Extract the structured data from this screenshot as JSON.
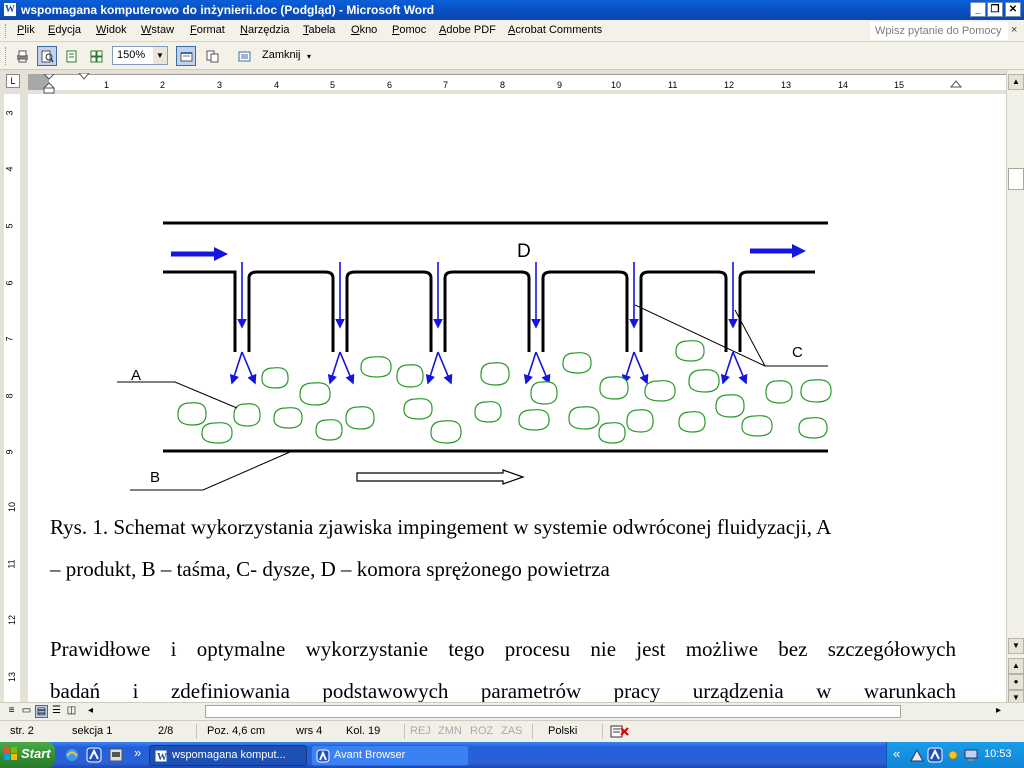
{
  "window": {
    "title": "wspomagana komputerowo do inżynierii.doc (Podgląd) - Microsoft Word",
    "controls": {
      "minimize": "_",
      "restore": "❐",
      "close": "✕"
    }
  },
  "menu": {
    "items": [
      "Plik",
      "Edycja",
      "Widok",
      "Wstaw",
      "Format",
      "Narzędzia",
      "Tabela",
      "Okno",
      "Pomoc",
      "Adobe PDF",
      "Acrobat Comments"
    ],
    "help_placeholder": "Wpisz pytanie do Pomocy",
    "help_close": "×"
  },
  "toolbar": {
    "zoom_value": "150%",
    "close_preview_label": "Zamknij",
    "icons": [
      "print-icon",
      "magnifier-icon",
      "one-page-icon",
      "multiple-pages-icon",
      "view-ruler-icon",
      "shrink-to-fit-icon",
      "full-screen-icon"
    ]
  },
  "ruler": {
    "horizontal_ticks": [
      "1",
      "2",
      "3",
      "4",
      "5",
      "6",
      "7",
      "8",
      "9",
      "10",
      "11",
      "12",
      "13",
      "14",
      "15"
    ],
    "vertical_ticks": [
      "3",
      "4",
      "5",
      "6",
      "7",
      "8",
      "9",
      "10",
      "11",
      "12",
      "13"
    ]
  },
  "figure": {
    "labels": {
      "a": "A",
      "b": "B",
      "c": "C",
      "d": "D"
    },
    "colors": {
      "arrow": "#1515e0",
      "product": "#2a9a2a",
      "line": "#000000"
    }
  },
  "document": {
    "caption_line1": "Rys. 1. Schemat wykorzystania zjawiska impingement w systemie odwróconej fluidyzacji, A",
    "caption_line2": "– produkt, B – taśma, C- dysze, D – komora sprężonego powietrza",
    "para_line1": "Prawidłowe i optymalne wykorzystanie tego procesu nie jest możliwe bez szczegółowych",
    "para_line2": "badań i zdefiniowania podstawowych parametrów pracy urządzenia w warunkach"
  },
  "status": {
    "page": "str. 2",
    "section": "sekcja 1",
    "page_of": "2/8",
    "position": "Poz. 4,6 cm",
    "line": "wrs 4",
    "column": "Kol. 19",
    "rec": "REJ",
    "trk": "ZMN",
    "ext": "ROZ",
    "ovr": "ZAS",
    "language": "Polski"
  },
  "taskbar": {
    "start_label": "Start",
    "more": "»",
    "tasks": [
      {
        "label": "wspomagana komput...",
        "active": true
      },
      {
        "label": "Avant Browser",
        "active": false
      }
    ],
    "tray_more": "«",
    "clock": "10:53"
  }
}
